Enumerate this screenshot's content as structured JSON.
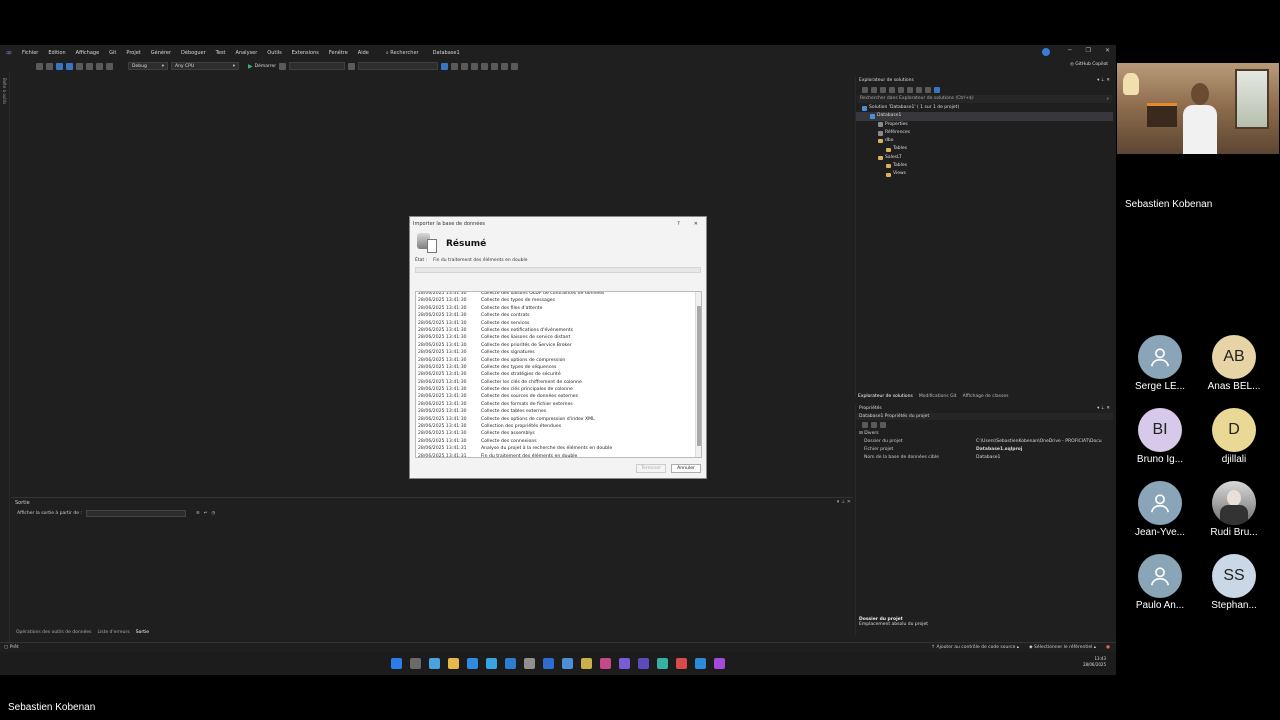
{
  "vs": {
    "menu": [
      "Fichier",
      "Edition",
      "Affichage",
      "Git",
      "Projet",
      "Générer",
      "Déboguer",
      "Test",
      "Analyser",
      "Outils",
      "Extensions",
      "Fenêtre",
      "Aide"
    ],
    "search_label": "Rechercher",
    "project_name": "Database1",
    "config": "Debug",
    "platform": "Any CPU",
    "run_label": "Démarrer",
    "copilot": "GitHub Copilot",
    "left_strip_label": "Boîte à outils",
    "colors": {
      "accent": "#3a7bd5",
      "background": "#1f1f1f"
    }
  },
  "output": {
    "title": "Sortie",
    "show_from": "Afficher la sortie à partir de :"
  },
  "bottom_tabs": [
    "Opérations des outils de données",
    "Liste d'erreurs",
    "Sortie"
  ],
  "solution_explorer": {
    "title": "Explorateur de solutions",
    "search_placeholder": "Rechercher dans Explorateur de solutions (Ctrl+$)",
    "tree": [
      {
        "label": "Solution 'Database1' ( 1 sur 1 de projet)",
        "depth": 0,
        "icon": "solution"
      },
      {
        "label": "Database1",
        "depth": 1,
        "icon": "db",
        "selected": true
      },
      {
        "label": "Properties",
        "depth": 2,
        "icon": "prop"
      },
      {
        "label": "Références",
        "depth": 2,
        "icon": "prop"
      },
      {
        "label": "dbo",
        "depth": 2,
        "icon": "folder"
      },
      {
        "label": "Tables",
        "depth": 3,
        "icon": "folder"
      },
      {
        "label": "SalesLT",
        "depth": 2,
        "icon": "folder"
      },
      {
        "label": "Tables",
        "depth": 3,
        "icon": "folder"
      },
      {
        "label": "Views",
        "depth": 3,
        "icon": "folder"
      }
    ],
    "tabs": [
      "Explorateur de solutions",
      "Modifications Git",
      "Affichage de classes"
    ]
  },
  "properties": {
    "title": "Propriétés",
    "subject": "Database1  Propriétés du projet",
    "category": "Divers",
    "rows": [
      {
        "key": "Dossier du projet",
        "value": "C:\\Users\\SebastienKobenan\\OneDrive - PROFICIAT\\Docu"
      },
      {
        "key": "Fichier projet",
        "value": "Database1.sqlproj",
        "bold": true
      },
      {
        "key": "Nom de la base de données cible",
        "value": "Database1"
      }
    ],
    "desc_title": "Dossier du projet",
    "desc_text": "Emplacement absolu du projet"
  },
  "status": {
    "left": "Prêt",
    "source_control": "Ajouter au contrôle de code source",
    "repo": "Sélectionner le référentiel"
  },
  "taskbar": {
    "time": "13:43",
    "date": "28/06/2025",
    "icons": [
      "#2b7de9",
      "#6a6a6a",
      "#4aa3df",
      "#e8b84a",
      "#2f8ae0",
      "#36a4e0",
      "#2c7cd2",
      "#909090",
      "#2e6bd2",
      "#4a8fd8",
      "#c9b04a",
      "#c24a8a",
      "#7a5bd6",
      "#5c4bb8",
      "#36b0a0",
      "#d94a4a",
      "#2b8ad9",
      "#a44ad9"
    ]
  },
  "dialog": {
    "title": "Importer la base de données",
    "help": "?",
    "close": "✕",
    "heading": "Résumé",
    "state_label": "État :",
    "state_value": "Fin du traitement des éléments en double",
    "log": [
      {
        "time": "28/06/2025 13:41:30",
        "msg": "Collecte des liaisons OLDF de contraintes de données"
      },
      {
        "time": "28/06/2025 13:41:30",
        "msg": "Collecte des types de messages"
      },
      {
        "time": "28/06/2025 13:41:30",
        "msg": "Collecte des files d'attente"
      },
      {
        "time": "28/06/2025 13:41:30",
        "msg": "Collecte des contrats"
      },
      {
        "time": "28/06/2025 13:41:30",
        "msg": "Collecte des services"
      },
      {
        "time": "28/06/2025 13:41:30",
        "msg": "Collecte des notifications d'événements"
      },
      {
        "time": "28/06/2025 13:41:30",
        "msg": "Collecte des liaisons de service distant"
      },
      {
        "time": "28/06/2025 13:41:30",
        "msg": "Collecte des priorités de Service Broker"
      },
      {
        "time": "28/06/2025 13:41:30",
        "msg": "Collecte des signatures"
      },
      {
        "time": "28/06/2025 13:41:30",
        "msg": "Collecte des options de compression"
      },
      {
        "time": "28/06/2025 13:41:30",
        "msg": "Collecte des types de séquences"
      },
      {
        "time": "28/06/2025 13:41:30",
        "msg": "Collecte des stratégies de sécurité"
      },
      {
        "time": "28/06/2025 13:41:30",
        "msg": "Collecter les clés de chiffrement de colonne"
      },
      {
        "time": "28/06/2025 13:41:30",
        "msg": "Collecte des clés principales de colonne"
      },
      {
        "time": "28/06/2025 13:41:30",
        "msg": "Collecte des sources de données externes"
      },
      {
        "time": "28/06/2025 13:41:30",
        "msg": "Collecte des formats de fichier externes"
      },
      {
        "time": "28/06/2025 13:41:30",
        "msg": "Collecte des tables externes"
      },
      {
        "time": "28/06/2025 13:41:30",
        "msg": "Collecte des options de compression d'index XML"
      },
      {
        "time": "28/06/2025 13:41:30",
        "msg": "Collection des propriétés étendues"
      },
      {
        "time": "28/06/2025 13:41:30",
        "msg": "Collecte des assemblys"
      },
      {
        "time": "28/06/2025 13:41:30",
        "msg": "Collecte des connexions"
      },
      {
        "time": "28/06/2025 13:41:31",
        "msg": "Analyse du projet à la recherche des éléments en double"
      },
      {
        "time": "28/06/2025 13:41:31",
        "msg": "Fin du traitement des éléments en double"
      }
    ],
    "finish_label": "Terminer",
    "cancel_label": "Annuler"
  },
  "meeting": {
    "presenter": "Sebastien Kobenan",
    "participants": [
      {
        "name": "Serge LE...",
        "initials": "",
        "color": "#8aa5b8",
        "kind": "generic"
      },
      {
        "name": "Anas BEL...",
        "initials": "AB",
        "color": "#e6d3a6",
        "kind": "initials"
      },
      {
        "name": "Bruno Ig...",
        "initials": "BI",
        "color": "#d7c9ea",
        "kind": "initials"
      },
      {
        "name": "djillali",
        "initials": "D",
        "color": "#ead996",
        "kind": "initials"
      },
      {
        "name": "Jean-Yve...",
        "initials": "",
        "color": "#8aa5b8",
        "kind": "generic"
      },
      {
        "name": "Rudi Bru...",
        "initials": "",
        "color": "#8a8a8a",
        "kind": "photo"
      },
      {
        "name": "Paulo An...",
        "initials": "",
        "color": "#8aa5b8",
        "kind": "generic"
      },
      {
        "name": "Stephan...",
        "initials": "SS",
        "color": "#c9d7e6",
        "kind": "initials"
      }
    ],
    "footer_name": "Sebastien Kobenan"
  }
}
